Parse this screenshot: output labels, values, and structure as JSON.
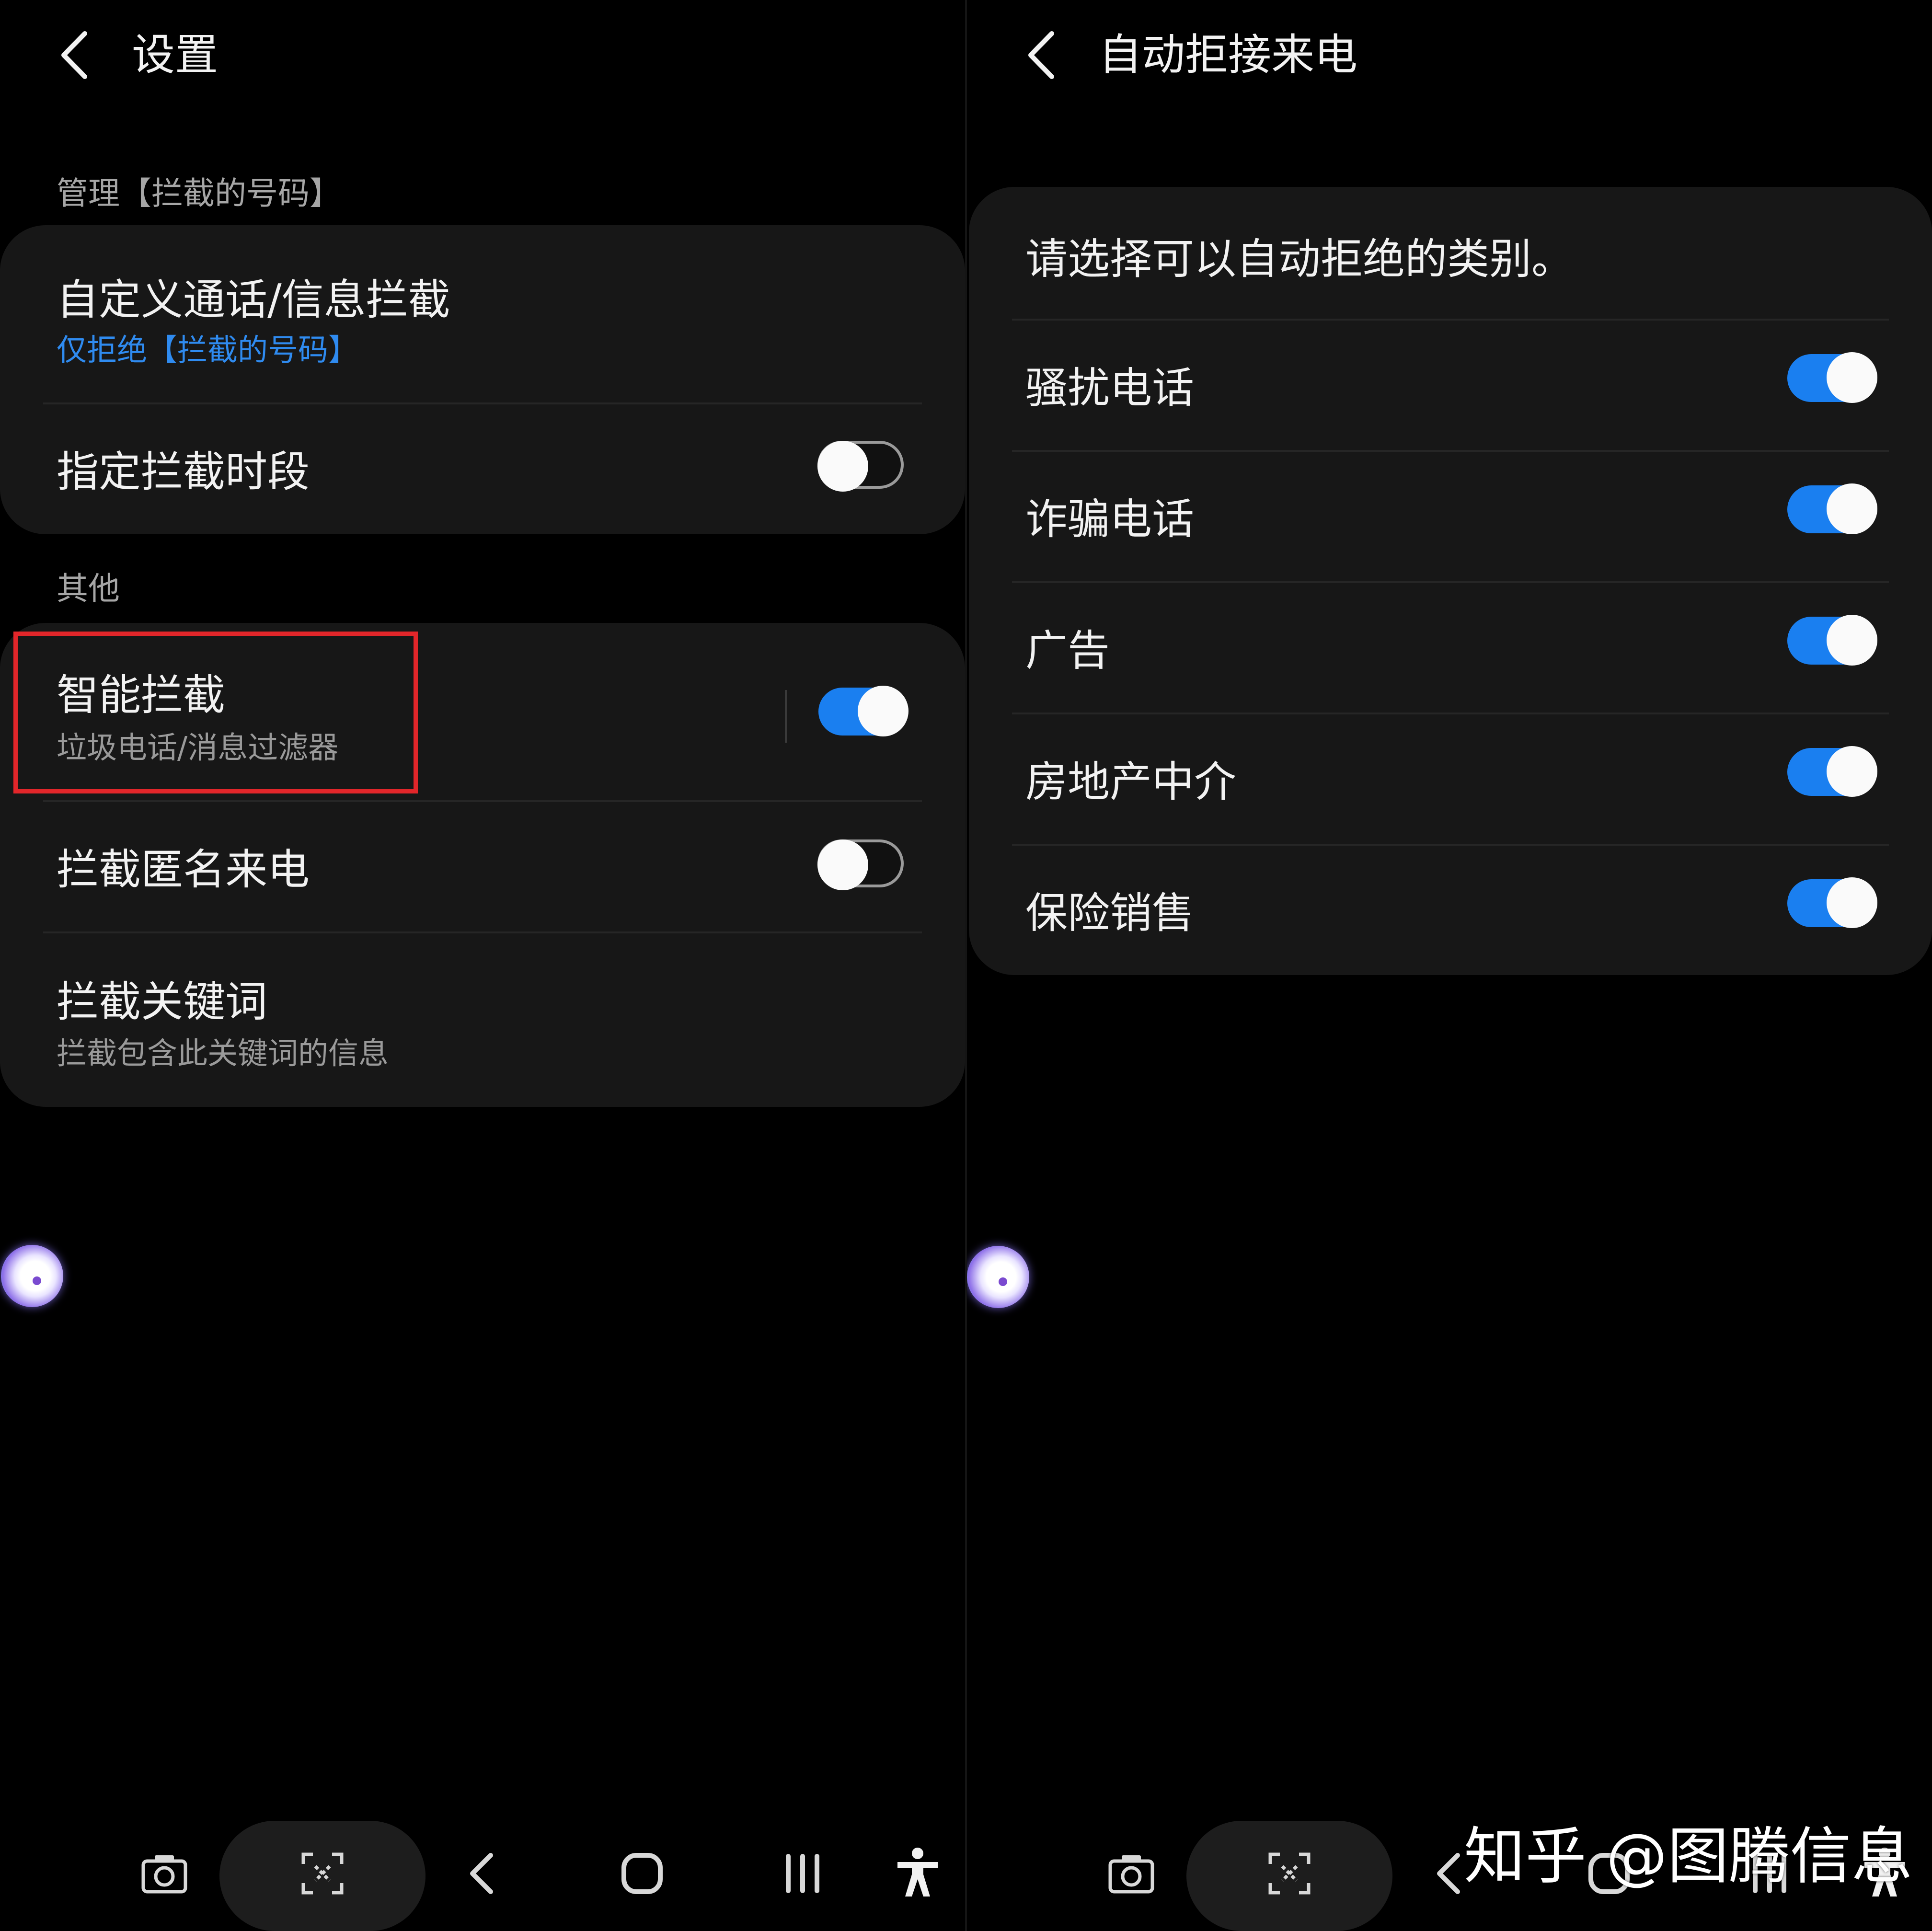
{
  "left": {
    "title": "设置",
    "section_manage": "管理【拦截的号码】",
    "custom_block": {
      "title": "自定义通话/信息拦截",
      "subtitle": "仅拒绝【拦截的号码】"
    },
    "schedule_block": {
      "title": "指定拦截时段",
      "toggle_on": false
    },
    "section_other": "其他",
    "smart_block": {
      "title": "智能拦截",
      "subtitle": "垃圾电话/消息过滤器",
      "toggle_on": true
    },
    "anonymous_block": {
      "title": "拦截匿名来电",
      "toggle_on": false
    },
    "keyword_block": {
      "title": "拦截关键词",
      "subtitle": "拦截包含此关键词的信息"
    }
  },
  "right": {
    "title": "自动拒接来电",
    "intro": "请选择可以自动拒绝的类别。",
    "categories": [
      {
        "label": "骚扰电话",
        "on": true
      },
      {
        "label": "诈骗电话",
        "on": true
      },
      {
        "label": "广告",
        "on": true
      },
      {
        "label": "房地产中介",
        "on": true
      },
      {
        "label": "保险销售",
        "on": true
      }
    ]
  },
  "watermark": "知乎 @图腾信息",
  "colors": {
    "background": "#000000",
    "card": "#171717",
    "accent": "#1a7ff0",
    "highlight": "#e2262a",
    "subtitle_blue": "#2f8bf0"
  },
  "icons": [
    "back-icon",
    "camera-icon",
    "scan-icon",
    "nav-back-icon",
    "home-icon",
    "recents-icon",
    "accessibility-icon"
  ]
}
